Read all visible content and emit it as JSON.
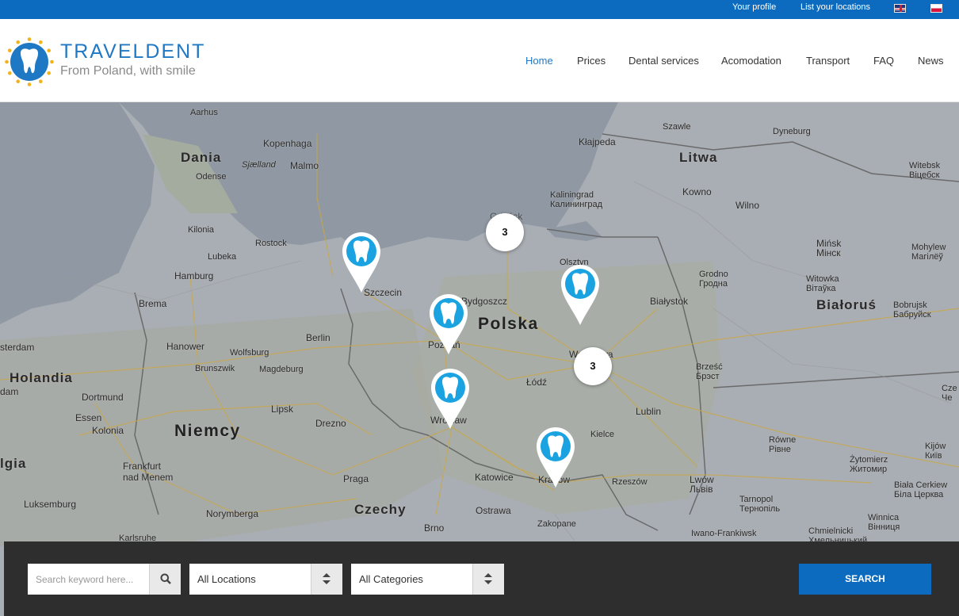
{
  "topbar": {
    "your_profile": "Your profile",
    "list_locations": "List your locations",
    "flags": [
      "english-flag",
      "polish-flag"
    ]
  },
  "brand": {
    "title": "TRAVELDENT",
    "tagline": "From Poland, with smile",
    "primary_color": "#0d6bbf"
  },
  "nav": {
    "items": [
      "Home",
      "Prices",
      "Dental services",
      "Acomodation",
      "Transport",
      "FAQ",
      "News"
    ],
    "active": "Home"
  },
  "map": {
    "labels": {
      "aarhus": "Aarhus",
      "dania": "Dania",
      "kopenhaga": "Kopenhaga",
      "sjaelland": "Sjælland",
      "malmo": "Malmo",
      "odense": "Odense",
      "kilonia": "Kilonia",
      "lubeka": "Lubeka",
      "rostock": "Rostock",
      "hamburg": "Hamburg",
      "brema": "Brema",
      "amsterdam": "sterdam",
      "holandia": "Holandia",
      "dam": "dam",
      "hanower": "Hanower",
      "berlin": "Berlin",
      "wolfsburg": "Wolfsburg",
      "brunszwik": "Brunszwik",
      "magdeburg": "Magdeburg",
      "dortmund": "Dortmund",
      "essen": "Essen",
      "kolonia": "Kolonia",
      "niemcy": "Niemcy",
      "lipsk": "Lipsk",
      "drezno": "Drezno",
      "belgia": "lgia",
      "frankfurt": "Frankfurt\nnad Menem",
      "luksemburg": "Luksemburg",
      "praga": "Praga",
      "czechy": "Czechy",
      "norymberga": "Norymberga",
      "karlsruhe": "Karlsruhe",
      "brno": "Brno",
      "ostrawa": "Ostrawa",
      "katowice": "Katowice",
      "zakopane": "Zakopane",
      "rzeszow": "Rzeszów",
      "szawle": "Szawle",
      "klajpeda": "Kłajpeda",
      "dyneburg": "Dyneburg",
      "litwa": "Litwa",
      "kaliningrad": "Kaliningrad\nКалининград",
      "kowno": "Kowno",
      "wilno": "Wilno",
      "witebsk": "Witebsk\nВіцебск",
      "gdansk": "Gdańsk",
      "szczecin": "Szczecin",
      "bydgoszcz": "Bydgoszcz",
      "polska": "Polska",
      "olsztyn": "Olsztyn",
      "grodno": "Grodno\nГродна",
      "minsk": "Mińsk\nМінск",
      "mohylew": "Mohylew\nМагілёў",
      "witowka": "Witowka\nВітаўка",
      "bialystok": "Białystok",
      "bialorus": "Białoruś",
      "bobrujsk": "Bobrujsk\nБабруйск",
      "poznan": "Poznań",
      "warszawa": "Warszawa",
      "lodz": "Łódź",
      "brzesc": "Brześć\nБрэст",
      "wroclaw": "Wrocław",
      "lublin": "Lublin",
      "kielce": "Kielce",
      "krakow": "Kraków",
      "rowne": "Równe\nРівне",
      "zytomierz": "Żytomierz\nЖитомир",
      "kijow": "Kijów\nКиїв",
      "czernihow": "Cze\nЧе",
      "lwow": "Lwów\nЛьвів",
      "tarnopol": "Tarnopol\nТернопіль",
      "biala_cerkiew": "Biała Cerkiew\nБіла Церква",
      "chmielnicki": "Chmielnicki\nХмельницький",
      "winnica": "Winnica\nВінниця",
      "iwano": "Iwano-Frankiwsk"
    },
    "clusters": [
      "3",
      "3"
    ],
    "pin_icon": "tooth-icon",
    "pin_color": "#1aa3e0"
  },
  "search": {
    "keyword_placeholder": "Search keyword here...",
    "locations_value": "All Locations",
    "categories_value": "All Categories",
    "button_label": "SEARCH"
  }
}
